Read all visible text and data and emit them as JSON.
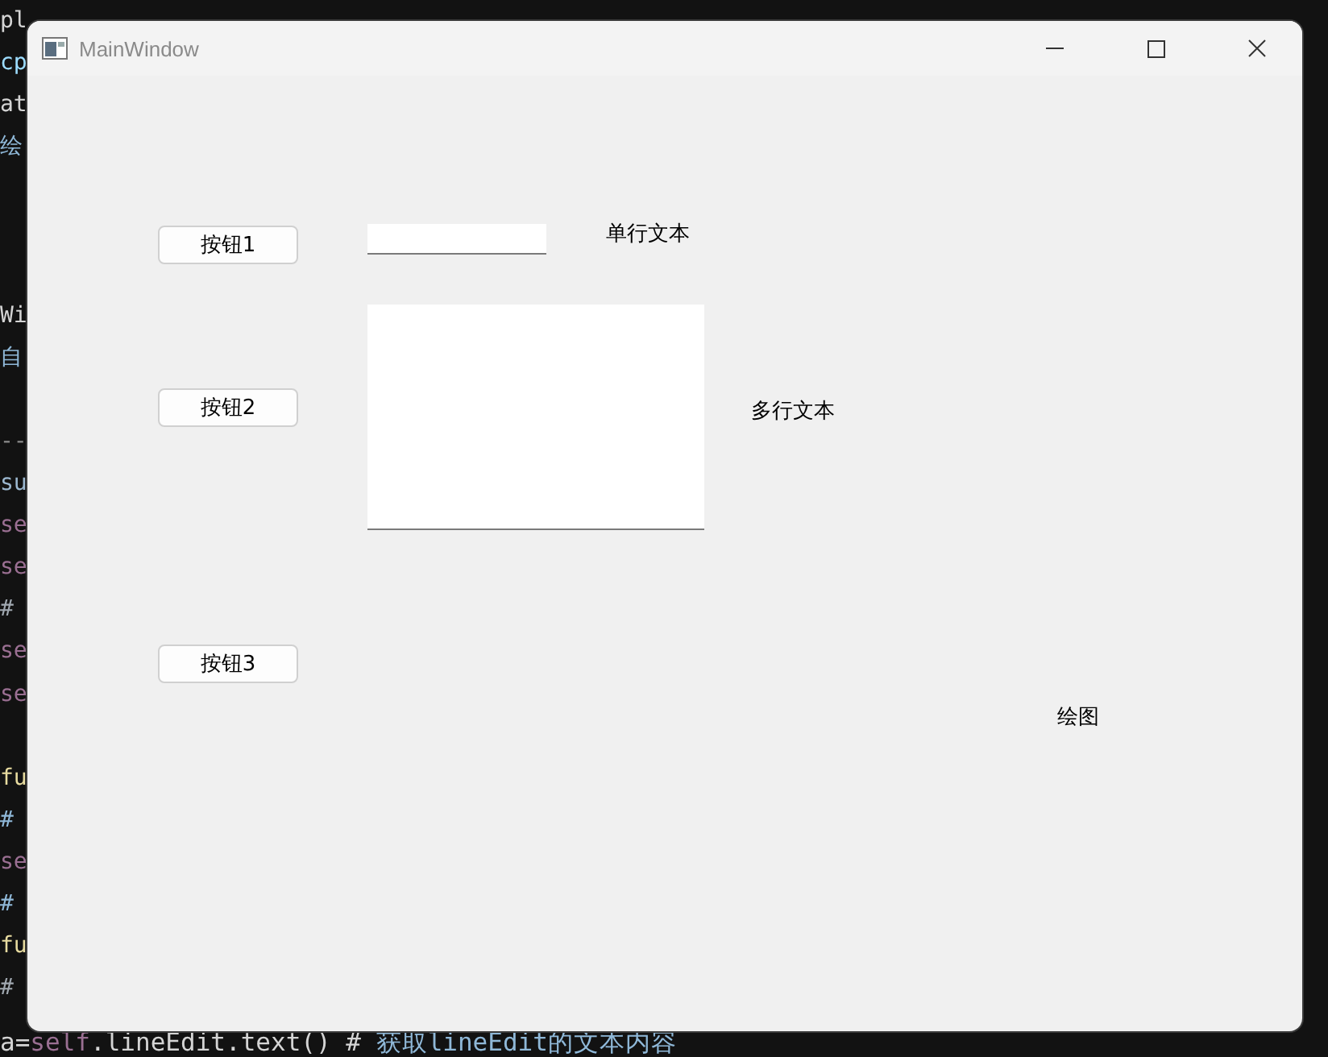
{
  "editor": {
    "lines": [
      {
        "kind": "code",
        "segments": [
          {
            "text": "pl",
            "color": "#d4d4d4"
          }
        ]
      },
      {
        "kind": "code",
        "segments": [
          {
            "text": "cp",
            "color": "#9cdcfe"
          }
        ]
      },
      {
        "kind": "code",
        "segments": [
          {
            "text": "at",
            "color": "#d4d4d4"
          }
        ]
      },
      {
        "kind": "code",
        "segments": [
          {
            "text": "绘",
            "color": "#8fb8d8"
          }
        ]
      },
      {
        "kind": "blank"
      },
      {
        "kind": "blank"
      },
      {
        "kind": "blank"
      },
      {
        "kind": "code",
        "segments": [
          {
            "text": "Wi",
            "color": "#d4d4d4"
          }
        ]
      },
      {
        "kind": "code",
        "segments": [
          {
            "text": "自",
            "color": "#8fb8d8"
          }
        ]
      },
      {
        "kind": "blank"
      },
      {
        "kind": "code",
        "segments": [
          {
            "text": "--",
            "color": "#8a8a8a"
          }
        ]
      },
      {
        "kind": "code",
        "segments": [
          {
            "text": "su",
            "color": "#9cb8d0"
          }
        ]
      },
      {
        "kind": "code",
        "segments": [
          {
            "text": "se",
            "color": "#9a6f92"
          }
        ]
      },
      {
        "kind": "code",
        "segments": [
          {
            "text": "se",
            "color": "#9a6f92"
          }
        ]
      },
      {
        "kind": "code",
        "segments": [
          {
            "text": "#",
            "color": "#a0a8b0"
          }
        ]
      },
      {
        "kind": "code",
        "segments": [
          {
            "text": "se",
            "color": "#9a6f92"
          }
        ]
      },
      {
        "kind": "code",
        "segments": [
          {
            "text": "se",
            "color": "#9a6f92"
          }
        ]
      },
      {
        "kind": "blank"
      },
      {
        "kind": "code",
        "segments": [
          {
            "text": "fu",
            "color": "#e8dca0"
          }
        ]
      },
      {
        "kind": "code",
        "segments": [
          {
            "text": "#",
            "color": "#8fb8d8"
          }
        ]
      },
      {
        "kind": "code",
        "segments": [
          {
            "text": "se",
            "color": "#9a6f92"
          }
        ]
      },
      {
        "kind": "code",
        "segments": [
          {
            "text": "#",
            "color": "#8fb8d8"
          }
        ]
      },
      {
        "kind": "code",
        "segments": [
          {
            "text": "fu",
            "color": "#e8dca0"
          }
        ]
      },
      {
        "kind": "code",
        "segments": [
          {
            "text": "#",
            "color": "#a0a8b0"
          }
        ]
      },
      {
        "kind": "full",
        "segments": [
          {
            "text": "a=",
            "color": "#d4d4d4"
          },
          {
            "text": "self",
            "color": "#9a6f92"
          },
          {
            "text": ".lineEdit.text() # ",
            "color": "#d4d4d4"
          },
          {
            "text": "获取lineEdit的文本内容",
            "color": "#8fb8d8"
          }
        ]
      }
    ]
  },
  "window": {
    "title": "MainWindow"
  },
  "buttons": [
    "按钮1",
    "按钮2",
    "按钮3"
  ],
  "line_edit": {
    "label": "单行文本"
  },
  "text_edit": {
    "label": "多行文本"
  },
  "paint_label": "绘图"
}
